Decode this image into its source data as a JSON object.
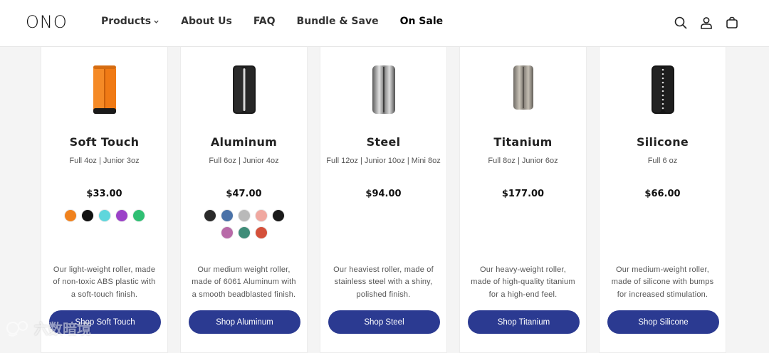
{
  "header": {
    "logo": "ONO",
    "nav": [
      {
        "label": "Products",
        "has_dropdown": true
      },
      {
        "label": "About Us"
      },
      {
        "label": "FAQ"
      },
      {
        "label": "Bundle & Save"
      },
      {
        "label": "On Sale"
      }
    ],
    "icons": [
      "search-icon",
      "account-icon",
      "cart-icon"
    ]
  },
  "products": [
    {
      "name": "Soft Touch",
      "weights": "Full 4oz | Junior 3oz",
      "price": "$33.00",
      "swatches": [
        "#f0821e",
        "#111111",
        "#5fd6dc",
        "#9b42c8",
        "#2fbf73"
      ],
      "description": "Our light-weight roller, made of non-toxic ABS plastic with a soft-touch finish.",
      "button": "Shop Soft Touch"
    },
    {
      "name": "Aluminum",
      "weights": "Full 6oz | Junior 4oz",
      "price": "$47.00",
      "swatches": [
        "#2a2a2a",
        "#4a72a8",
        "#b9b9b9",
        "#f0a8a0",
        "#1a1a1a",
        "#b86aa8",
        "#3f8c78",
        "#d4503a"
      ],
      "description": "Our medium weight roller, made of 6061 Aluminum with a smooth beadblasted finish.",
      "button": "Shop Aluminum"
    },
    {
      "name": "Steel",
      "weights": "Full 12oz | Junior 10oz | Mini 8oz",
      "price": "$94.00",
      "swatches": [],
      "description": "Our heaviest roller, made of stainless steel with a shiny, polished finish.",
      "button": "Shop Steel"
    },
    {
      "name": "Titanium",
      "weights": "Full 8oz | Junior 6oz",
      "price": "$177.00",
      "swatches": [],
      "description": "Our heavy-weight roller, made of high-quality titanium for a high-end feel.",
      "button": "Shop Titanium"
    },
    {
      "name": "Silicone",
      "weights": "Full 6 oz",
      "price": "$66.00",
      "swatches": [],
      "description": "Our medium-weight roller, made of silicone with bumps for increased stimulation.",
      "button": "Shop Silicone"
    }
  ],
  "watermark": "六数暗境",
  "colors": {
    "button_bg": "#2b3a91",
    "page_bg": "#f4f4f4"
  }
}
